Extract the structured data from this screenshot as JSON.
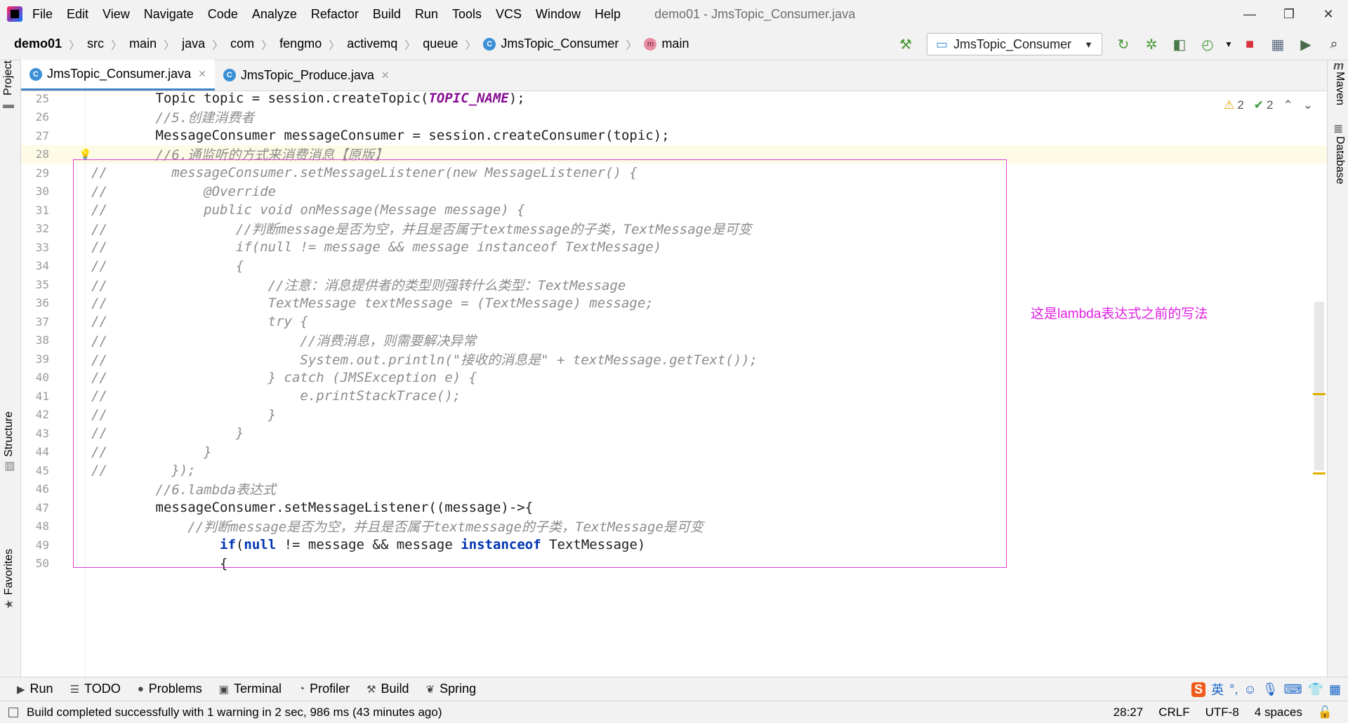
{
  "menu": [
    "File",
    "Edit",
    "View",
    "Navigate",
    "Code",
    "Analyze",
    "Refactor",
    "Build",
    "Run",
    "Tools",
    "VCS",
    "Window",
    "Help"
  ],
  "window_title": "demo01 - JmsTopic_Consumer.java",
  "breadcrumbs": [
    "demo01",
    "src",
    "main",
    "java",
    "com",
    "fengmo",
    "activemq",
    "queue",
    "JmsTopic_Consumer",
    "main"
  ],
  "run_config": "JmsTopic_Consumer",
  "editor_tabs": [
    {
      "label": "JmsTopic_Consumer.java",
      "active": true
    },
    {
      "label": "JmsTopic_Produce.java",
      "active": false
    }
  ],
  "left_tools": [
    "Project",
    "Structure",
    "Favorites"
  ],
  "right_tools": [
    "Maven",
    "Database"
  ],
  "inspections": {
    "warnings": "2",
    "weak_warnings": "2"
  },
  "annotation": "这是lambda表达式之前的写法",
  "code_lines": [
    {
      "num": "25",
      "text": "        Topic topic = session.createTopic(TOPIC_NAME);"
    },
    {
      "num": "26",
      "text": "        //5.创建消费者"
    },
    {
      "num": "27",
      "text": "        MessageConsumer messageConsumer = session.createConsumer(topic);"
    },
    {
      "num": "28",
      "text": "        //6.通监听的方式来消费消息【原版】"
    },
    {
      "num": "29",
      "text": "//        messageConsumer.setMessageListener(new MessageListener() {"
    },
    {
      "num": "30",
      "text": "//            @Override"
    },
    {
      "num": "31",
      "text": "//            public void onMessage(Message message) {"
    },
    {
      "num": "32",
      "text": "//                //判断message是否为空，并且是否属于textmessage的子类，TextMessage是可变"
    },
    {
      "num": "33",
      "text": "//                if(null != message && message instanceof TextMessage)"
    },
    {
      "num": "34",
      "text": "//                {"
    },
    {
      "num": "35",
      "text": "//                    //注意：消息提供者的类型则强转什么类型：TextMessage"
    },
    {
      "num": "36",
      "text": "//                    TextMessage textMessage = (TextMessage) message;"
    },
    {
      "num": "37",
      "text": "//                    try {"
    },
    {
      "num": "38",
      "text": "//                        //消费消息，则需要解决异常"
    },
    {
      "num": "39",
      "text": "//                        System.out.println(\"接收的消息是\" + textMessage.getText());"
    },
    {
      "num": "40",
      "text": "//                    } catch (JMSException e) {"
    },
    {
      "num": "41",
      "text": "//                        e.printStackTrace();"
    },
    {
      "num": "42",
      "text": "//                    }"
    },
    {
      "num": "43",
      "text": "//                }"
    },
    {
      "num": "44",
      "text": "//            }"
    },
    {
      "num": "45",
      "text": "//        });"
    },
    {
      "num": "46",
      "text": "        //6.lambda表达式"
    },
    {
      "num": "47",
      "text": "        messageConsumer.setMessageListener((message)->{"
    },
    {
      "num": "48",
      "text": "            //判断message是否为空，并且是否属于textmessage的子类，TextMessage是可变"
    },
    {
      "num": "49",
      "text": "                if(null != message && message instanceof TextMessage)"
    },
    {
      "num": "50",
      "text": "                {"
    }
  ],
  "bottom_tools": [
    {
      "label": "Run",
      "icon": "run-icon",
      "glyph": "▶"
    },
    {
      "label": "TODO",
      "icon": "todo-icon",
      "glyph": "☰"
    },
    {
      "label": "Problems",
      "icon": "problems-icon",
      "glyph": "●"
    },
    {
      "label": "Terminal",
      "icon": "terminal-icon",
      "glyph": "▣"
    },
    {
      "label": "Profiler",
      "icon": "profiler-icon",
      "glyph": "◔"
    },
    {
      "label": "Build",
      "icon": "build-icon",
      "glyph": "⚒"
    },
    {
      "label": "Spring",
      "icon": "spring-icon",
      "glyph": "❦"
    }
  ],
  "ime_label": "英",
  "status": {
    "message": "Build completed successfully with 1 warning in 2 sec, 986 ms (43 minutes ago)",
    "position": "28:27",
    "line_sep": "CRLF",
    "encoding": "UTF-8",
    "indent": "4 spaces"
  },
  "colors": {
    "keyword": "#0033b3",
    "comment": "#8c8c8c",
    "constant": "#871094",
    "annotation_text": "#e020e0",
    "selection_border": "#e040e0",
    "current_line": "#fdfbe5"
  }
}
